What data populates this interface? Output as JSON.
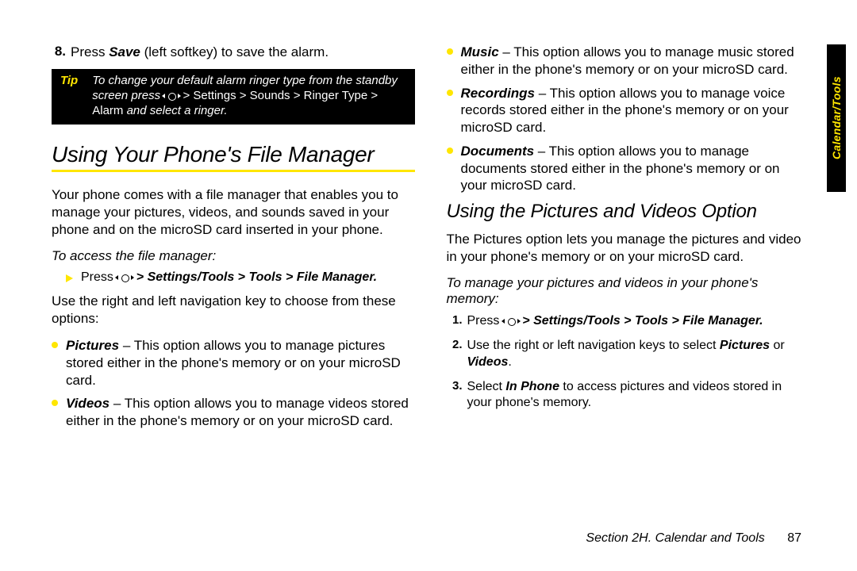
{
  "side_tab": {
    "label": "Calendar/Tools"
  },
  "left": {
    "step8": {
      "num": "8.",
      "pre": "Press ",
      "bold": "Save",
      "post": " (left softkey) to save the alarm."
    },
    "tip": {
      "label": "Tip",
      "line1_pre": "To change your default alarm ringer type from the ",
      "line1_post": "standby screen press ",
      "path1": " > Settings > Sounds > ",
      "line2": "Ringer Type > Alarm ",
      "line2_post": "and select a ringer."
    },
    "h1": "Using Your Phone's File Manager",
    "intro": "Your phone comes with a file manager that enables you to manage your pictures, videos, and sounds saved in your phone and on the microSD card inserted in your phone.",
    "lead": "To access the file manager:",
    "arrow_pre": "Press ",
    "arrow_path": " > Settings/Tools > Tools > File Manager.",
    "nav_line": "Use the right and left navigation key to choose from these options:",
    "bullets": [
      {
        "b": "Pictures",
        "t": " – This option allows you to manage pictures stored either in the phone's memory or on your microSD card."
      },
      {
        "b": "Videos",
        "t": " – This option allows you to manage videos stored either in the phone's memory or on your microSD card."
      }
    ]
  },
  "right": {
    "bullets": [
      {
        "b": "Music",
        "t": " – This option allows you to manage music stored either in the phone's memory or on your microSD card."
      },
      {
        "b": "Recordings",
        "t": " – This option allows you to manage voice records stored either in the phone's memory or on your microSD card."
      },
      {
        "b": "Documents",
        "t": " – This option allows you to manage documents stored either in the phone's memory or on your microSD card."
      }
    ],
    "h2": "Using the Pictures and Videos Option",
    "intro": "The Pictures option lets you manage the pictures and video in your phone's memory or on your microSD card.",
    "lead": "To manage your pictures and videos in your phone's memory:",
    "steps": [
      {
        "n": "1.",
        "pre": "Press ",
        "path": " > Settings/Tools > Tools > File Manager."
      },
      {
        "n": "2.",
        "pre": "Use the right or left navigation keys to select ",
        "b1": "Pictures",
        "mid": " or ",
        "b2": "Videos",
        "post": "."
      },
      {
        "n": "3.",
        "pre": "Select ",
        "b1": "In Phone",
        "post": " to access pictures and videos stored in your phone's memory."
      }
    ]
  },
  "footer": {
    "section": "Section 2H. Calendar and Tools",
    "page": "87"
  }
}
